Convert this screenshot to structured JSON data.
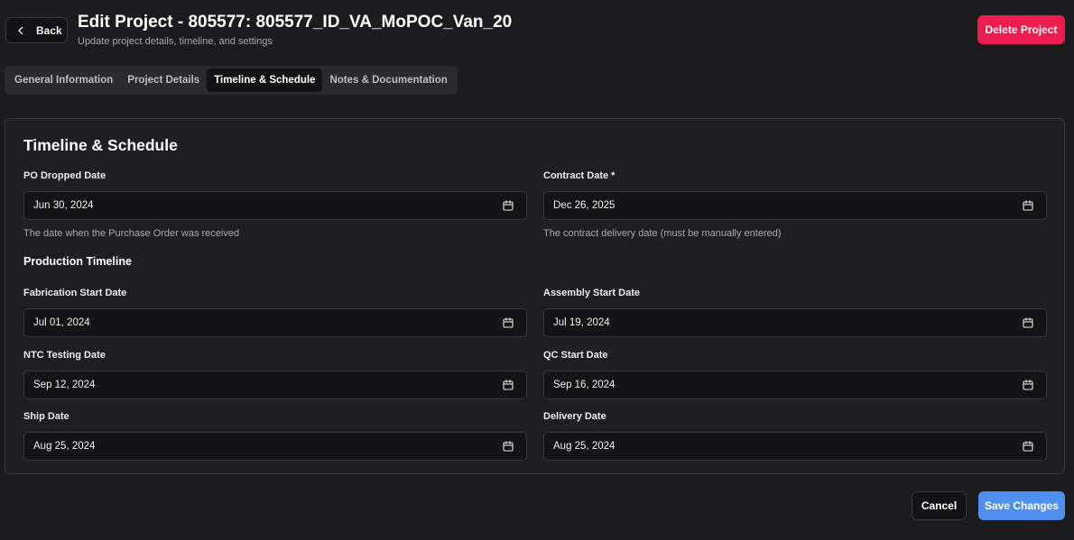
{
  "header": {
    "back_label": "Back",
    "title": "Edit Project - 805577: 805577_ID_VA_MoPOC_Van_20",
    "subtitle": "Update project details, timeline, and settings",
    "delete_label": "Delete Project"
  },
  "tabs": [
    {
      "label": "General Information",
      "active": false
    },
    {
      "label": "Project Details",
      "active": false
    },
    {
      "label": "Timeline & Schedule",
      "active": true
    },
    {
      "label": "Notes & Documentation",
      "active": false
    }
  ],
  "card": {
    "title": "Timeline & Schedule",
    "po_dropped": {
      "label": "PO Dropped Date",
      "value": "Jun 30, 2024",
      "helper": "The date when the Purchase Order was received"
    },
    "contract": {
      "label": "Contract Date *",
      "value": "Dec 26, 2025",
      "helper": "The contract delivery date (must be manually entered)"
    },
    "production_title": "Production Timeline",
    "fabrication_start": {
      "label": "Fabrication Start Date",
      "value": "Jul 01, 2024"
    },
    "assembly_start": {
      "label": "Assembly Start Date",
      "value": "Jul 19, 2024"
    },
    "ntc_testing": {
      "label": "NTC Testing Date",
      "value": "Sep 12, 2024"
    },
    "qc_start": {
      "label": "QC Start Date",
      "value": "Sep 16, 2024"
    },
    "ship": {
      "label": "Ship Date",
      "value": "Aug 25, 2024"
    },
    "delivery": {
      "label": "Delivery Date",
      "value": "Aug 25, 2024"
    }
  },
  "footer": {
    "cancel_label": "Cancel",
    "save_label": "Save Changes"
  },
  "colors": {
    "background": "#1c1c1e",
    "delete_button": "#ee1c4f",
    "save_button": "#4f8ff0"
  },
  "icons": {
    "back": "chevron-left-icon",
    "date_picker": "calendar-icon"
  }
}
